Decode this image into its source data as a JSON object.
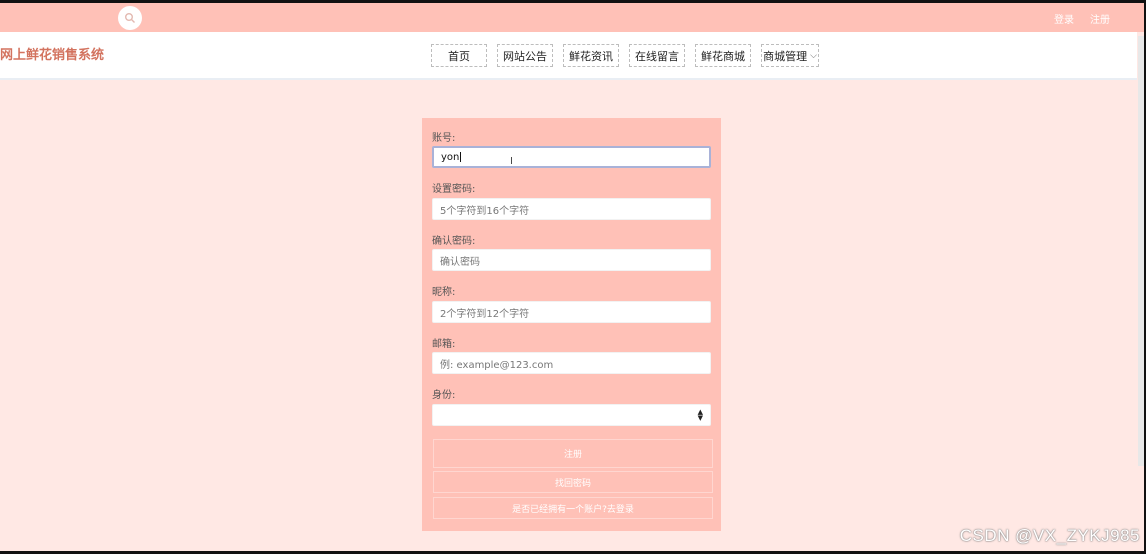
{
  "topbar": {
    "links": {
      "login": "登录",
      "register": "注册"
    },
    "search_icon": "search-icon"
  },
  "header": {
    "site_title": "网上鲜花销售系统",
    "nav": [
      "首页",
      "网站公告",
      "鲜花资讯",
      "在线留言",
      "鲜花商城",
      "商城管理"
    ]
  },
  "form": {
    "account": {
      "label": "账号:",
      "value": "yon"
    },
    "password": {
      "label": "设置密码:",
      "placeholder": "5个字符到16个字符"
    },
    "confirm": {
      "label": "确认密码:",
      "placeholder": "确认密码"
    },
    "nickname": {
      "label": "昵称:",
      "placeholder": "2个字符到12个字符"
    },
    "email": {
      "label": "邮箱:",
      "placeholder": "例: example@123.com"
    },
    "role": {
      "label": "身份:",
      "value": ""
    },
    "buttons": {
      "register": "注册",
      "forgot": "找回密码",
      "go_login": "是否已经拥有一个账户?去登录"
    }
  },
  "watermark": "CSDN @VX_ZYKJ985",
  "colors": {
    "topbar": "#ffc1b7",
    "page_bg": "#ffe8e4",
    "panel": "#ffc1b7",
    "title": "#d3735f"
  }
}
